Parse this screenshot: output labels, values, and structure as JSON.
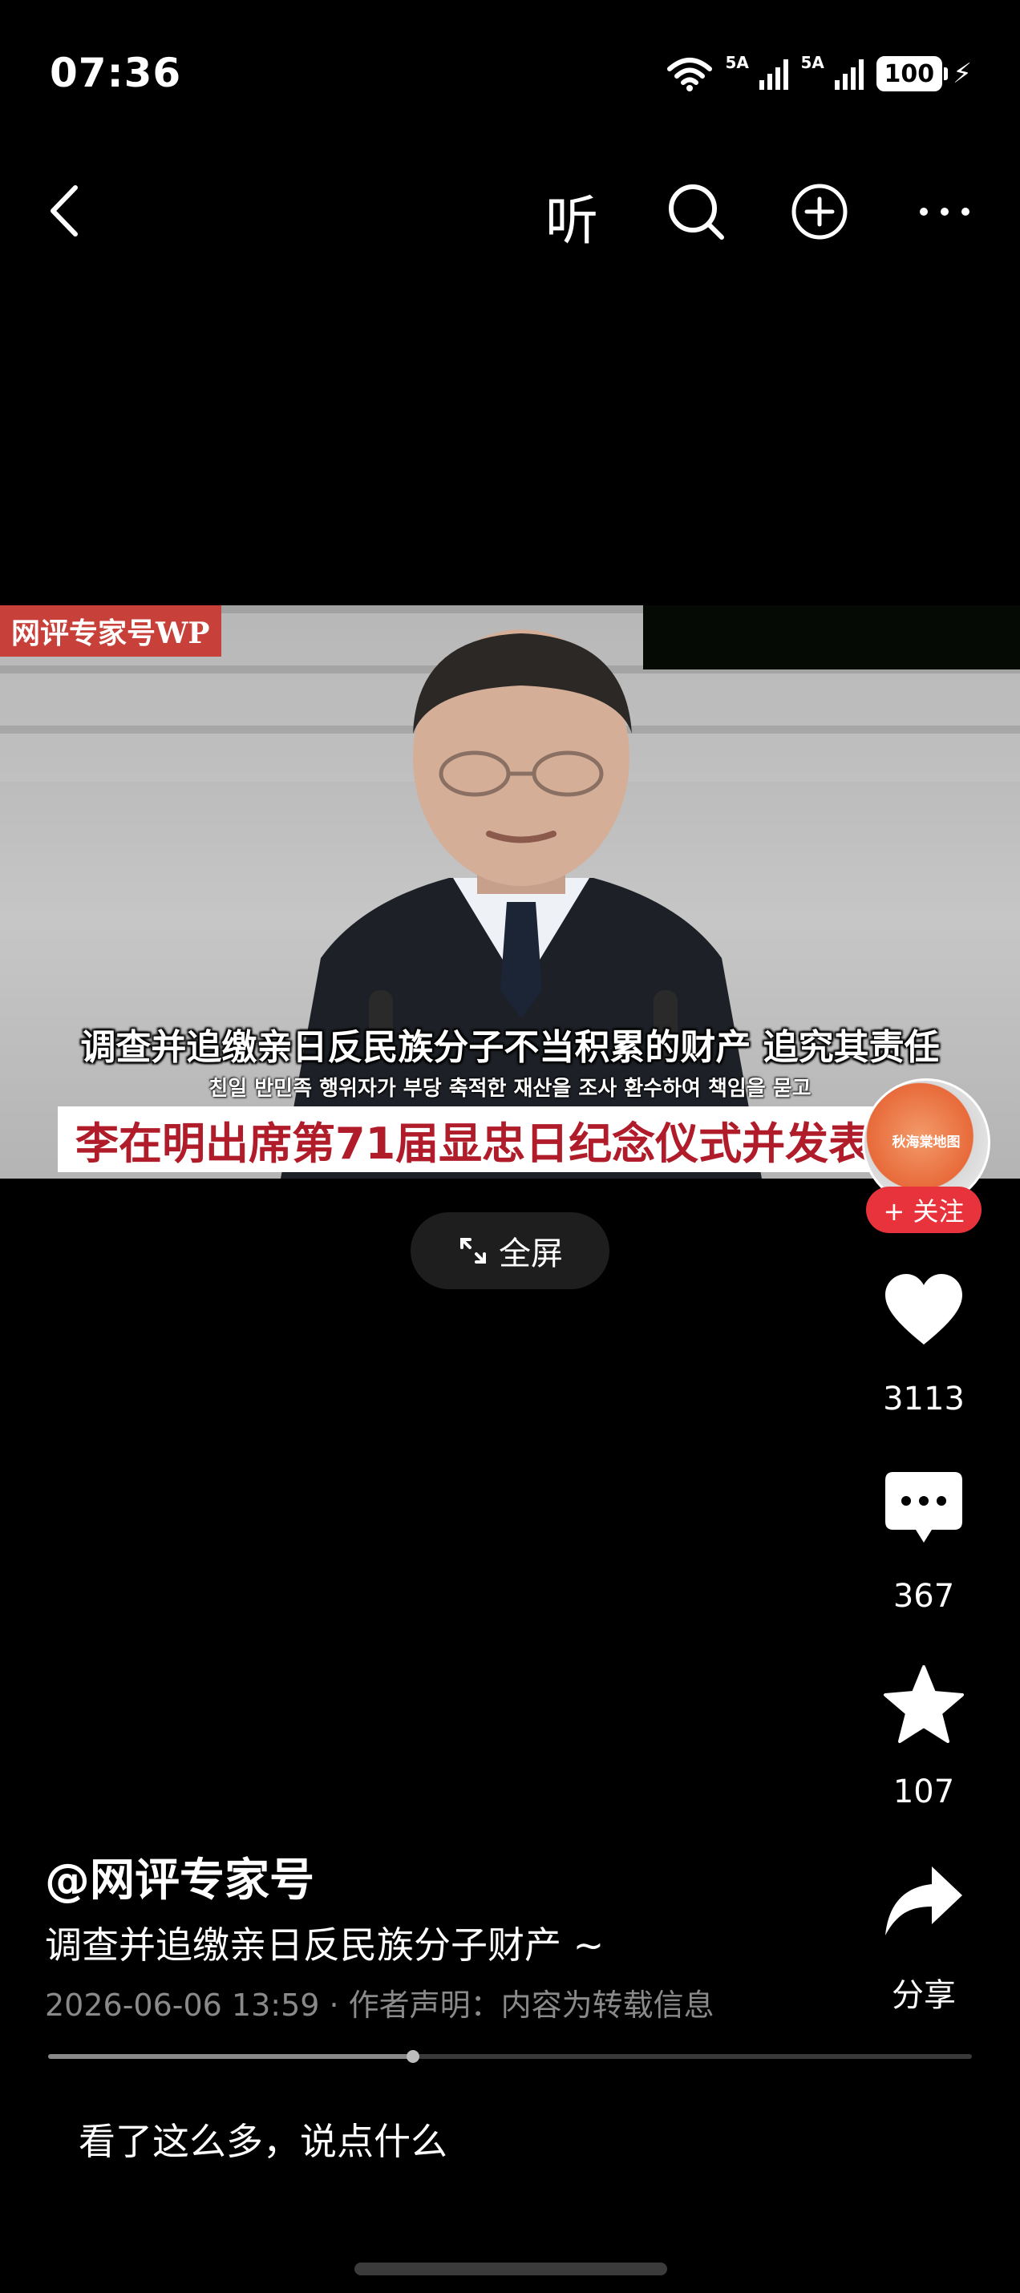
{
  "status_bar": {
    "time": "07:36",
    "net1": "5A",
    "net2": "5A",
    "battery": "100",
    "icons": [
      "wifi-icon",
      "signal-icon",
      "signal-icon",
      "battery-icon",
      "charging-icon"
    ]
  },
  "nav": {
    "listen_label": "听",
    "icons": [
      "back-icon",
      "search-icon",
      "add-icon",
      "more-icon"
    ]
  },
  "video": {
    "watermark": "网评专家号WP",
    "caption_cn": "调查并追缴亲日反民族分子不当积累的财产 追究其责任",
    "caption_kr": "친일 반민족 행위자가 부당 축적한 재산을 조사 환수하여 책임을 묻고",
    "title_banner": "李在明出席第71届显忠日纪念仪式并发表讲话"
  },
  "fullscreen_label": "全屏",
  "rail": {
    "avatar_text": "秋海棠地图",
    "follow_label": "+ 关注",
    "likes": "3113",
    "comments": "367",
    "favorites": "107",
    "share_label": "分享"
  },
  "post": {
    "author": "@网评专家号",
    "description": "调查并追缴亲日反民族分子财产 ~",
    "meta": "2026-06-06 13:59 · 作者声明：内容为转载信息",
    "progress": 0.395
  },
  "comment_placeholder": "看了这么多，说点什么"
}
